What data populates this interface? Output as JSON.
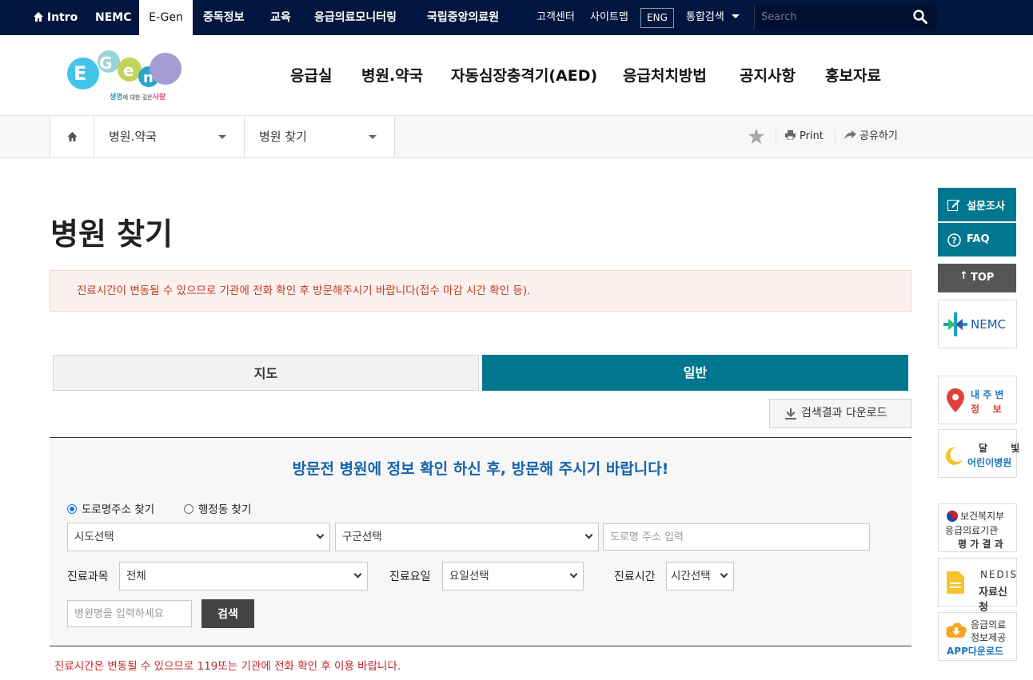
{
  "topbar": {
    "intro": "Intro",
    "nemc": "NEMC",
    "egen": "E-Gen",
    "addiction": "중독정보",
    "education": "교육",
    "monitoring": "응급의료모니터링",
    "central_hospital": "국립중앙의료원",
    "customer_center": "고객센터",
    "sitemap": "사이트맵",
    "eng": "ENG",
    "integrated_search": "통합검색",
    "search_placeholder": "Search"
  },
  "logo": {
    "tagline_a": "생명",
    "tagline_b": "에 대한 깊은",
    "tagline_c": "사랑"
  },
  "gnb": [
    "응급실",
    "병원.약국",
    "자동심장충격기(AED)",
    "응급처치방법",
    "공지사항",
    "홍보자료"
  ],
  "breadcrumb": {
    "level1": "병원.약국",
    "level2": "병원 찾기",
    "print": "Print",
    "share": "공유하기"
  },
  "page": {
    "title": "병원 찾기",
    "notice": "진료시간이 변동될 수 있으므로 기관에 전화 확인 후 방문해주시기 바랍니다(접수 마감 시간 확인 등).",
    "tab_map": "지도",
    "tab_general": "일반",
    "download": "검색결과 다운로드",
    "footer_note": "진료시간은 변동될 수 있으므로 119또는 기관에 전화 확인 후 이용 바랍니다."
  },
  "search": {
    "heading": "방문전 병원에 정보 확인 하신 후, 방문해 주시기 바랍니다!",
    "radio_road": "도로명주소 찾기",
    "radio_admin": "행정동 찾기",
    "sido": "시도선택",
    "gugun": "구군선택",
    "road_placeholder": "도로명 주소 입력",
    "dept_label": "진료과목",
    "dept_value": "전체",
    "day_label": "진료요일",
    "day_value": "요일선택",
    "time_label": "진료시간",
    "time_value": "시간선택",
    "name_placeholder": "병원명을 입력하세요",
    "button": "검색"
  },
  "quickmenu": {
    "survey": "설문조사",
    "faq": "FAQ",
    "top": "TOP",
    "nemc": "NEMC",
    "nearby_a": "내 주 변",
    "nearby_b": "정    보",
    "moon_a": "달       빛",
    "moon_b": "어린이병원",
    "mohw": "보건복지부",
    "eval_a": "응급의료기관",
    "eval_b": "평 가 결 과",
    "nedis_a": "NEDIS",
    "nedis_b": "자료신청",
    "app_a": "응급의료",
    "app_b": "정보제공",
    "app_c": "APP다운로드"
  },
  "colors": {
    "topbar": "#01163f",
    "teal": "#00778f",
    "notice_text": "#c13a20",
    "heading_blue": "#1563ad",
    "warning_red": "#c1272d"
  }
}
